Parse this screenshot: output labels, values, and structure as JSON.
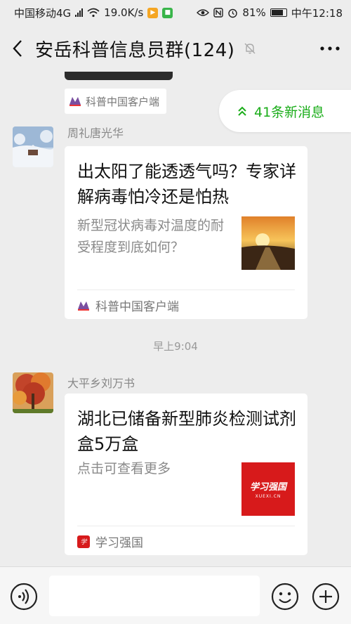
{
  "status": {
    "carrier": "中国移动4G",
    "net_sup": "4G",
    "speed": "19.0K/s",
    "battery": "81%",
    "time": "中午12:18"
  },
  "header": {
    "title": "安岳科普信息员群(124)"
  },
  "prev_message": {
    "source": "科普中国客户端"
  },
  "new_messages": {
    "label": "41条新消息"
  },
  "messages": [
    {
      "sender": "周礼唐光华",
      "card_title": "出太阳了能透透气吗？专家详解病毒怕冷还是怕热",
      "card_desc": "新型冠状病毒对温度的耐受程度到底如何？",
      "source": "科普中国客户端"
    },
    {
      "sender": "大平乡刘万书",
      "card_title": "湖北已储备新型肺炎检测试剂盒5万盒",
      "card_desc": "点击可查看更多",
      "thumb_logo": "学习强国",
      "thumb_sub": "XUEXI.CN",
      "source": "学习强国"
    }
  ],
  "time_separator": "早上9:04",
  "colors": {
    "accent_green": "#1aad19",
    "background": "#ededed",
    "xuexi_red": "#d71a1b"
  }
}
